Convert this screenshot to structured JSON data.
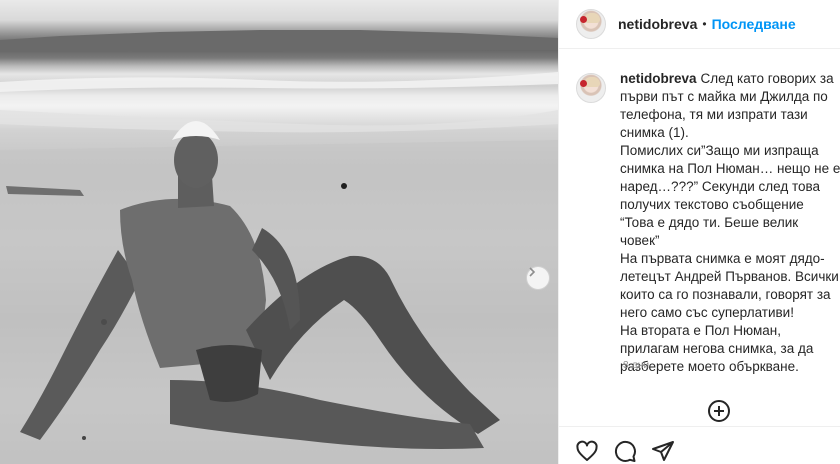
{
  "post": {
    "username": "netidobreva",
    "separator": "•",
    "follow_label": "Последване",
    "caption_text": "След като говорих за първи път с майка ми Джилда по телефона, тя ми изпрати тази снимка (1).\nПомислих си”Защо ми изпраща снимка на Пол Нюман… нещо не е наред…???” Секунди след това получих текстово съобщение “Това е дядо ти. Беше велик човек”\nНа първата снимка е моят дядо-летецът Андрей Първанов. Всички които са го познавали, говорят за него само със суперлативи!\nНа втората е Пол Нюман, прилагам негова снимка, за да разберете моето объркване.",
    "time_ago": "3 дни"
  },
  "icons": {
    "carousel_next": "chevron-right-icon",
    "add_comment": "plus-circle-icon",
    "like": "heart-icon",
    "comment": "comment-bubble-icon",
    "share": "paper-plane-icon"
  },
  "colors": {
    "accent": "#0095f6",
    "text": "#262626",
    "muted": "#8e8e8e",
    "divider": "#efefef"
  }
}
